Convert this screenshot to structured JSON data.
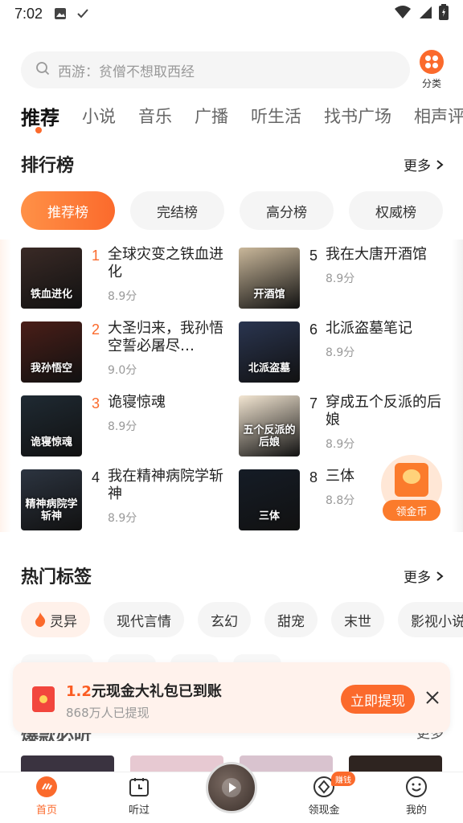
{
  "status_bar": {
    "time": "7:02"
  },
  "search": {
    "placeholder": "西游：贫僧不想取西经"
  },
  "category": {
    "label": "分类"
  },
  "tabs": [
    "推荐",
    "小说",
    "音乐",
    "广播",
    "听生活",
    "找书广场",
    "相声评书"
  ],
  "ranking": {
    "title": "排行榜",
    "more": "更多",
    "chips": [
      "推荐榜",
      "完结榜",
      "高分榜",
      "权威榜"
    ],
    "items": [
      {
        "num": "1",
        "title": "全球灾变之铁血进化",
        "score": "8.9分",
        "cover_text": "铁血进化",
        "color": "#3a2a26"
      },
      {
        "num": "2",
        "title": "大圣归来，我孙悟空誓必屠尽…",
        "score": "9.0分",
        "cover_text": "我孙悟空",
        "color": "#4a1e18"
      },
      {
        "num": "3",
        "title": "诡寝惊魂",
        "score": "8.9分",
        "cover_text": "诡寝惊魂",
        "color": "#1f2a33"
      },
      {
        "num": "4",
        "title": "我在精神病院学斩神",
        "score": "8.9分",
        "cover_text": "精神病院学斩神",
        "color": "#2c3440"
      },
      {
        "num": "5",
        "title": "我在大唐开酒馆",
        "score": "8.9分",
        "cover_text": "开酒馆",
        "color": "#c9b79a"
      },
      {
        "num": "6",
        "title": "北派盗墓笔记",
        "score": "8.9分",
        "cover_text": "北派盗墓",
        "color": "#2a3550"
      },
      {
        "num": "7",
        "title": "穿成五个反派的后娘",
        "score": "8.9分",
        "cover_text": "五个反派的后娘",
        "color": "#f3e6d2"
      },
      {
        "num": "8",
        "title": "三体",
        "score": "8.8分",
        "cover_text": "三体",
        "color": "#151c26"
      }
    ]
  },
  "coin_float": {
    "label": "领金币"
  },
  "hot_tags": {
    "title": "热门标签",
    "more": "更多",
    "tags": [
      "灵异",
      "现代言情",
      "玄幻",
      "甜宠",
      "末世",
      "影视小说"
    ]
  },
  "toast": {
    "amount": "1.2",
    "message": "元现金大礼包已到账",
    "sub": "868万人已提现",
    "button": "立即提现"
  },
  "next_section": {
    "title": "爆款必听",
    "more": "更多"
  },
  "bottom_nav": {
    "items": [
      "首页",
      "听过",
      "领现金",
      "我的"
    ],
    "badge": "赚钱"
  },
  "colors": {
    "accent": "#fb6a2c",
    "rank_top3": "#fb6a2c",
    "rank_other": "#222222"
  }
}
